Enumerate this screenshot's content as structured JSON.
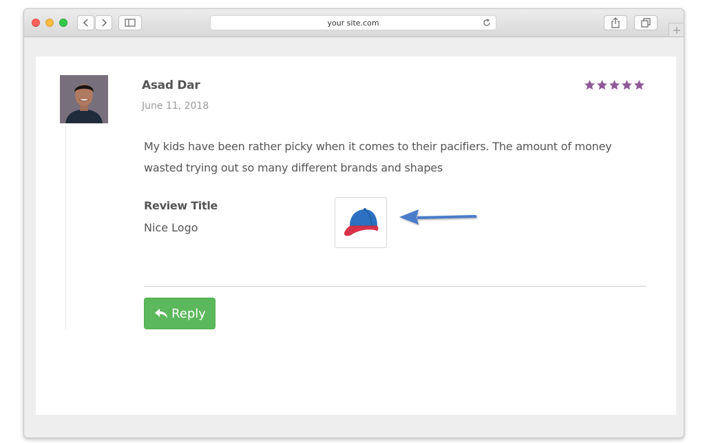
{
  "browser": {
    "address": "your site.com",
    "icons": {
      "back": "chevron-left-icon",
      "forward": "chevron-right-icon",
      "sidebar": "sidebar-icon",
      "reload": "reload-icon",
      "share": "share-icon",
      "tabs": "tabs-icon",
      "new_tab": "plus-icon"
    }
  },
  "review": {
    "author": "Asad Dar",
    "date": "June 11, 2018",
    "rating": 5,
    "rating_max": 5,
    "star_color": "#8f5a97",
    "text": "My kids have been rather picky when it comes to their pacifiers. The amount of money wasted trying out so many different brands and shapes",
    "title_label": "Review Title",
    "title_value": "Nice Logo",
    "attachment_icon": "cap-icon",
    "reply_label": "Reply",
    "reply_color": "#5cb85c",
    "arrow_color": "#4a7cc9"
  }
}
